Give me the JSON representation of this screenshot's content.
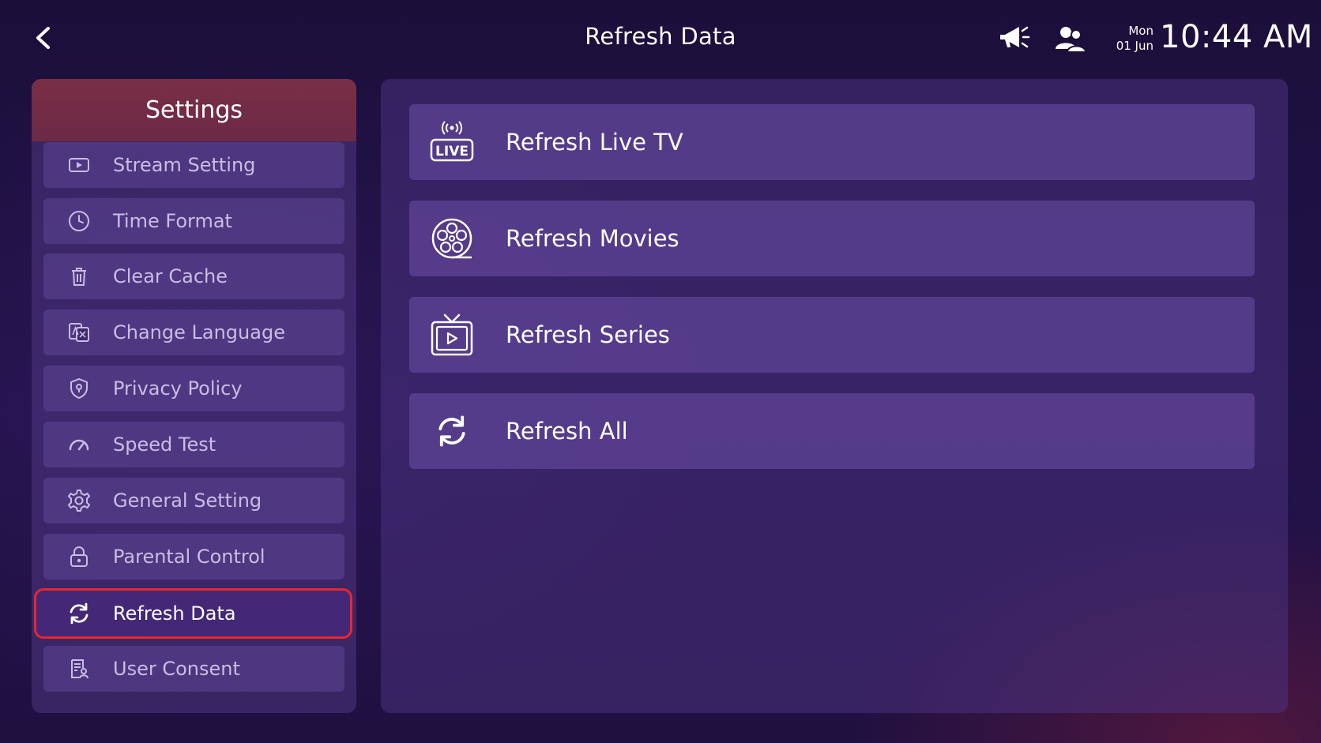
{
  "header": {
    "title": "Refresh Data",
    "date_day": "Mon",
    "date_date": "01 Jun",
    "time": "10:44 AM",
    "icons": [
      "back-arrow-icon",
      "megaphone-icon",
      "users-icon"
    ]
  },
  "sidebar": {
    "title": "Settings",
    "items": [
      {
        "label": "Stream Setting",
        "icon": "play-box-icon"
      },
      {
        "label": "Time Format",
        "icon": "clock-icon"
      },
      {
        "label": "Clear Cache",
        "icon": "trash-icon"
      },
      {
        "label": "Change Language",
        "icon": "translate-icon"
      },
      {
        "label": "Privacy Policy",
        "icon": "shield-icon"
      },
      {
        "label": "Speed Test",
        "icon": "speedometer-icon"
      },
      {
        "label": "General Setting",
        "icon": "gear-icon"
      },
      {
        "label": "Parental Control",
        "icon": "lock-icon"
      },
      {
        "label": "Refresh Data",
        "icon": "refresh-icon",
        "active": true
      },
      {
        "label": "User Consent",
        "icon": "document-user-icon"
      }
    ]
  },
  "main": {
    "actions": [
      {
        "label": "Refresh Live TV",
        "icon": "live-broadcast-icon",
        "icon_text": "LIVE"
      },
      {
        "label": "Refresh Movies",
        "icon": "film-reel-icon"
      },
      {
        "label": "Refresh Series",
        "icon": "tv-play-icon"
      },
      {
        "label": "Refresh All",
        "icon": "refresh-icon"
      }
    ]
  },
  "colors": {
    "background": "#1b0f3a",
    "sidebar_header": "#7a2e47",
    "active_outline": "#e8262b",
    "item_text": "#c9bde4"
  }
}
